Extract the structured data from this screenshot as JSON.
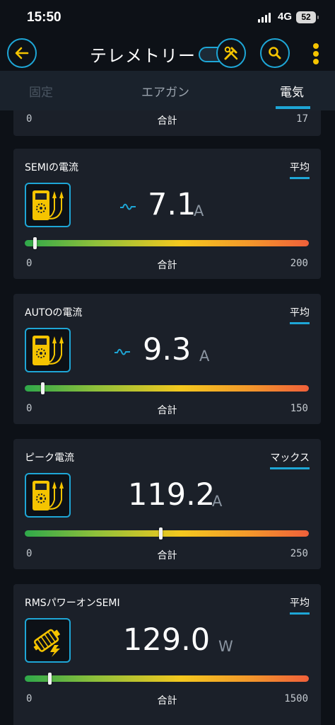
{
  "status": {
    "time": "15:50",
    "network": "4G",
    "battery": "52"
  },
  "header": {
    "title": "テレメトリー"
  },
  "tabs": [
    {
      "label": "固定"
    },
    {
      "label": "エアガン"
    },
    {
      "label": "電気"
    }
  ],
  "top_card": {
    "min": "0",
    "mid": "合計",
    "max": "17"
  },
  "cards": [
    {
      "label": "SEMIの電流",
      "mode": "平均",
      "value": "7.1",
      "unit": "A",
      "min": "0",
      "mid": "合計",
      "max": "200",
      "level": 0.035,
      "icon": "multimeter-icon",
      "wave": true
    },
    {
      "label": "AUTOの電流",
      "mode": "平均",
      "value": "9.3",
      "unit": "A",
      "min": "0",
      "mid": "合計",
      "max": "150",
      "level": 0.062,
      "icon": "multimeter-icon",
      "wave": true
    },
    {
      "label": "ピーク電流",
      "mode": "マックス",
      "value": "119.2",
      "unit": "A",
      "min": "0",
      "mid": "合計",
      "max": "250",
      "level": 0.477,
      "icon": "multimeter-icon",
      "wave": false
    },
    {
      "label": "RMSパワーオンSEMI",
      "mode": "平均",
      "value": "129.0",
      "unit": "W",
      "min": "0",
      "mid": "合計",
      "max": "1500",
      "level": 0.086,
      "icon": "motor-power-icon",
      "wave": false
    }
  ],
  "colors": {
    "accent": "#1ea6d6",
    "icon_yellow": "#f5c400",
    "background": "#0d1117",
    "card": "#1b2029"
  }
}
